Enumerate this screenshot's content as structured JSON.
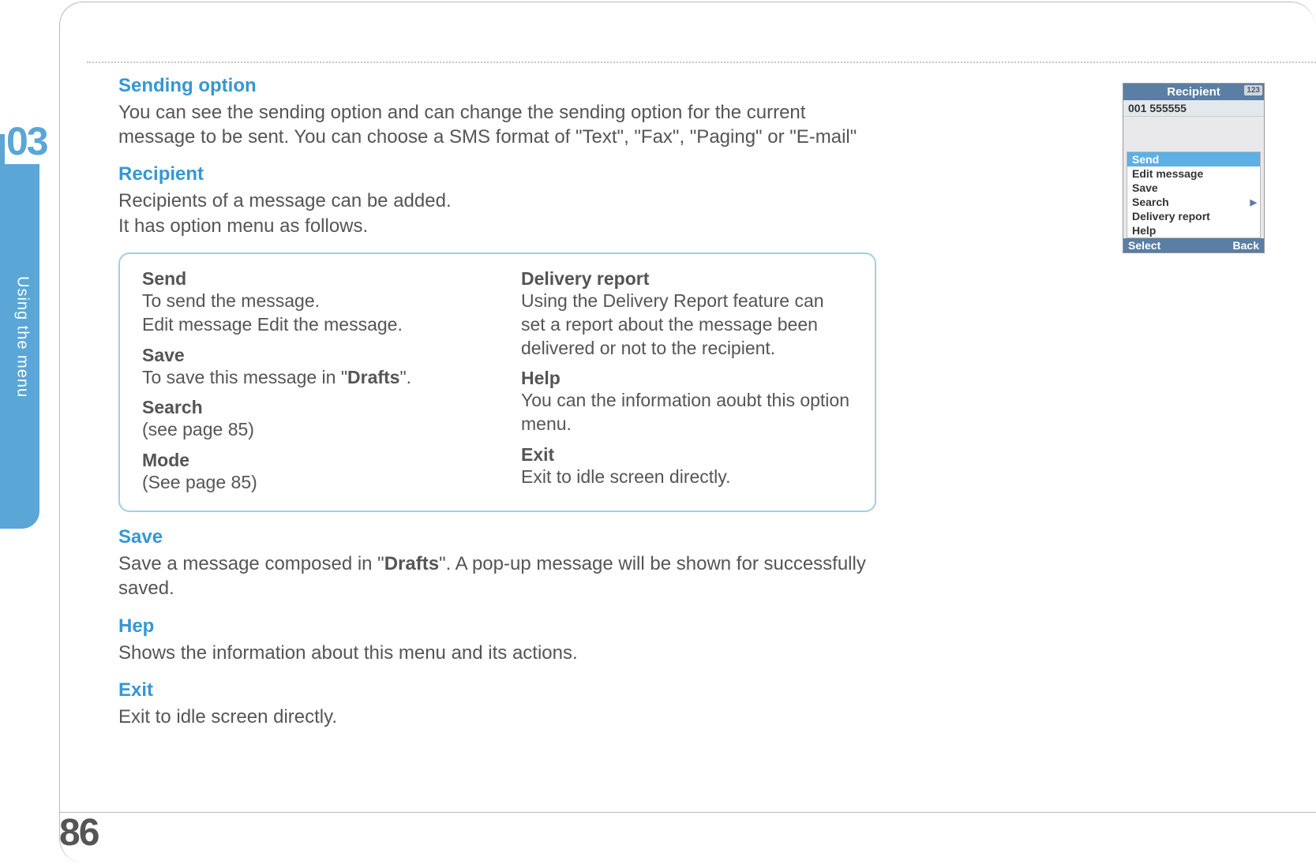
{
  "sidebar": {
    "chapter_number": "03",
    "label": "Using the menu"
  },
  "page_number": "86",
  "sections": {
    "sending_option": {
      "title": "Sending option",
      "body": "You can see the sending option and can change the sending option for the current message to be sent. You can choose a SMS format of \"Text\", \"Fax\", \"Paging\" or \"E-mail\""
    },
    "recipient": {
      "title": "Recipient",
      "body_line1": "Recipients of a message can be added.",
      "body_line2": "It has option menu as follows."
    },
    "save": {
      "title": "Save",
      "body_pre": "Save a message composed in \"",
      "body_bold": "Drafts",
      "body_post": "\". A pop-up message will be shown for successfully saved."
    },
    "hep": {
      "title": "Hep",
      "body": "Shows the information about this menu and its actions."
    },
    "exit": {
      "title": "Exit",
      "body": "Exit to idle screen directly."
    }
  },
  "options_box": {
    "left": {
      "send": {
        "label": "Send",
        "line1": "To send the message.",
        "line2": "Edit message Edit the message."
      },
      "save": {
        "label": "Save",
        "pre": "To save this message in \"",
        "bold": "Drafts",
        "post": "\"."
      },
      "search": {
        "label": "Search",
        "desc": "(see page 85)"
      },
      "mode": {
        "label": "Mode",
        "desc": "(See page 85)"
      }
    },
    "right": {
      "delivery": {
        "label": "Delivery report",
        "desc": "Using the Delivery Report feature can set a report about the message been delivered or not to the recipient."
      },
      "help": {
        "label": "Help",
        "desc": "You can the information aoubt this option menu."
      },
      "exit": {
        "label": "Exit",
        "desc": "Exit to idle screen directly."
      }
    }
  },
  "phone": {
    "title": "Recipient",
    "title_badge": "123",
    "number_row": "001 555555",
    "menu": {
      "item0": "Send",
      "item1": "Edit message",
      "item2": "Save",
      "item3": "Search",
      "item4": "Delivery report",
      "item5": "Help"
    },
    "footer_left": "Select",
    "footer_right": "Back"
  }
}
